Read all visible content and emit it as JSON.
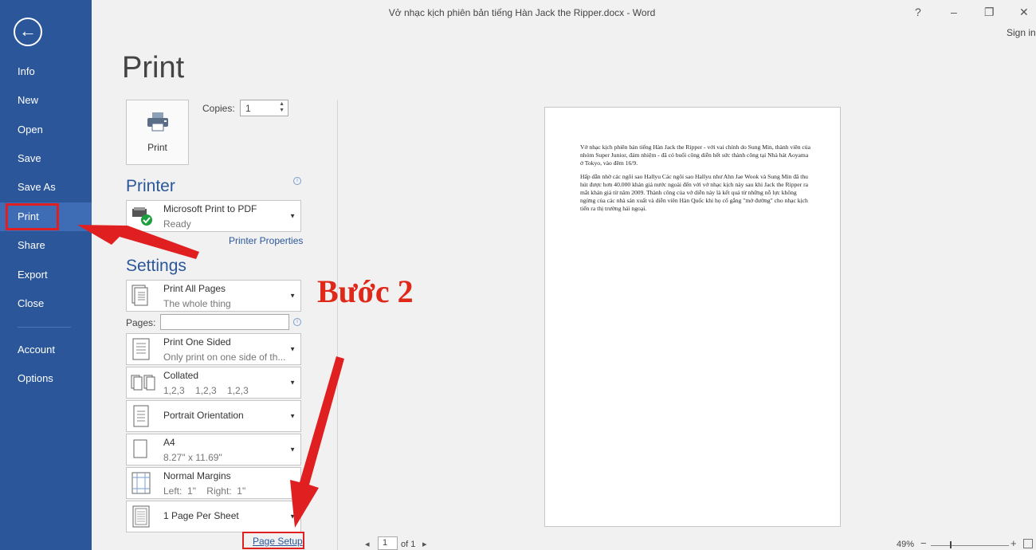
{
  "window": {
    "title": "Vở nhạc kịch phiên bản tiếng Hàn Jack the Ripper.docx - Word",
    "help": "?",
    "minimize": "–",
    "restore": "❐",
    "close": "✕",
    "sign_in": "Sign in"
  },
  "sidebar": {
    "back_icon": "←",
    "items": [
      {
        "label": "Info"
      },
      {
        "label": "New"
      },
      {
        "label": "Open"
      },
      {
        "label": "Save"
      },
      {
        "label": "Save As"
      },
      {
        "label": "Print",
        "active": true
      },
      {
        "label": "Share"
      },
      {
        "label": "Export"
      },
      {
        "label": "Close"
      },
      {
        "label": "Account"
      },
      {
        "label": "Options"
      }
    ]
  },
  "print": {
    "title": "Print",
    "button_label": "Print",
    "copies_label": "Copies:",
    "copies_value": "1",
    "printer_heading": "Printer",
    "printer_name": "Microsoft Print to PDF",
    "printer_status": "Ready",
    "printer_properties": "Printer Properties",
    "settings_heading": "Settings",
    "settings": [
      {
        "line1": "Print All Pages",
        "line2": "The whole thing"
      },
      {
        "line1": "Print One Sided",
        "line2": "Only print on one side of th..."
      },
      {
        "line1": "Collated",
        "line2": "1,2,3    1,2,3    1,2,3"
      },
      {
        "line1": "Portrait Orientation",
        "line2": ""
      },
      {
        "line1": "A4",
        "line2": "8.27\" x 11.69\""
      },
      {
        "line1": "Normal Margins",
        "line2": "Left:  1\"    Right:  1\""
      },
      {
        "line1": "1 Page Per Sheet",
        "line2": ""
      }
    ],
    "pages_label": "Pages:",
    "pages_value": "",
    "page_setup": "Page Setup"
  },
  "preview": {
    "para1": "Vở nhạc kịch phiên bản tiếng Hàn Jack the Ripper - với vai chính do Sung Min, thành viên của nhóm Super Junior, đảm nhiệm - đã có buổi công diễn hết sức thành công tại Nhà hát Aoyama ở Tokyo, vào đêm 16/9.",
    "para2": "Hấp dẫn nhờ các ngôi sao Hallyu Các ngôi sao Hallyu như Ahn Jae Wook và Sung Min đã thu hút được hơn 40.000 khán giả nước ngoài đến với vở nhạc kịch này sau khi Jack the Ripper ra mắt khán giả từ năm 2009. Thành công của vở diễn này là kết quả từ những nỗ lực không ngừng của các nhà sản xuất và diễn viên Hàn Quốc khi họ cố gắng \"mở đường\" cho nhạc kịch tiến ra thị trường hải ngoại.",
    "current_page": "1",
    "of_pages": "of 1",
    "zoom": "49%"
  },
  "annotation": {
    "step_label": "Bước 2",
    "color": "#e0281a"
  }
}
